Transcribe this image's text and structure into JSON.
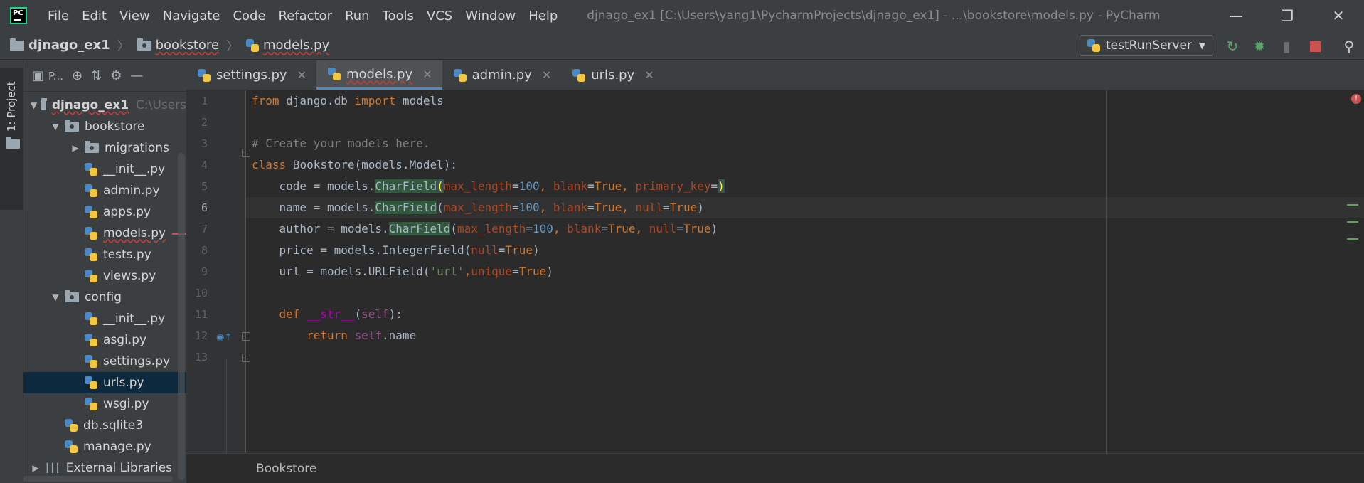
{
  "titlebar": {
    "logo": "PC",
    "menu": [
      "File",
      "Edit",
      "View",
      "Navigate",
      "Code",
      "Refactor",
      "Run",
      "Tools",
      "VCS",
      "Window",
      "Help"
    ],
    "window_title": "djnago_ex1 [C:\\Users\\yang1\\PycharmProjects\\djnago_ex1] - ...\\bookstore\\models.py - PyCharm",
    "controls": [
      "minimize-icon",
      "restore-icon",
      "close-icon"
    ]
  },
  "navbar": {
    "crumbs": [
      "djnago_ex1",
      "bookstore",
      "models.py"
    ],
    "run_config": "testRunServer"
  },
  "stripe": {
    "project_label": "1: Project"
  },
  "panel": {
    "view_label": "P..."
  },
  "tree": [
    {
      "label": "djnago_ex1",
      "hint": "C:\\Users",
      "type": "folder",
      "depth": 0,
      "expanded": true,
      "bold": true
    },
    {
      "label": "bookstore",
      "type": "folder",
      "depth": 1,
      "expanded": true
    },
    {
      "label": "migrations",
      "type": "folder",
      "depth": 2,
      "expanded": false
    },
    {
      "label": "__init__.py",
      "type": "py",
      "depth": 2
    },
    {
      "label": "admin.py",
      "type": "py",
      "depth": 2
    },
    {
      "label": "apps.py",
      "type": "py",
      "depth": 2
    },
    {
      "label": "models.py",
      "type": "py",
      "depth": 2,
      "error": true
    },
    {
      "label": "tests.py",
      "type": "py",
      "depth": 2
    },
    {
      "label": "views.py",
      "type": "py",
      "depth": 2
    },
    {
      "label": "config",
      "type": "folder",
      "depth": 1,
      "expanded": true
    },
    {
      "label": "__init__.py",
      "type": "py",
      "depth": 2
    },
    {
      "label": "asgi.py",
      "type": "py",
      "depth": 2
    },
    {
      "label": "settings.py",
      "type": "py",
      "depth": 2
    },
    {
      "label": "urls.py",
      "type": "py",
      "depth": 2,
      "selected": true
    },
    {
      "label": "wsgi.py",
      "type": "py",
      "depth": 2
    },
    {
      "label": "db.sqlite3",
      "type": "db",
      "depth": 1
    },
    {
      "label": "manage.py",
      "type": "py",
      "depth": 1
    },
    {
      "label": "External Libraries",
      "type": "lib",
      "depth": 0,
      "expanded": false
    }
  ],
  "tabs": [
    {
      "label": "settings.py",
      "active": false
    },
    {
      "label": "models.py",
      "active": true
    },
    {
      "label": "admin.py",
      "active": false
    },
    {
      "label": "urls.py",
      "active": false
    }
  ],
  "editor": {
    "line_numbers": [
      "1",
      "2",
      "3",
      "4",
      "5",
      "6",
      "7",
      "8",
      "9",
      "10",
      "11",
      "12",
      "13"
    ],
    "lines": [
      "from django.db import models",
      "",
      "# Create your models here.",
      "",
      "class Bookstore(models.Model):",
      "    code = models.CharField(max_length=100, blank=True, primary_key=)",
      "    name = models.CharField(max_length=100, blank=True, null=True)",
      "    author = models.CharField(max_length=100, blank=True, null=True)",
      "    price = models.IntegerField(null=True)",
      "    url = models.URLField('url',unique=True)",
      "",
      "    def __str__(self):",
      "        return self.name"
    ],
    "current_line": 6
  },
  "statusbar": {
    "breadcrumb": "Bookstore"
  },
  "colors": {
    "keyword": "#cc7832",
    "comment": "#808080",
    "string": "#6a8759",
    "number": "#6897bb",
    "param": "#aa4926",
    "self": "#94558d",
    "magic": "#b200b2"
  }
}
